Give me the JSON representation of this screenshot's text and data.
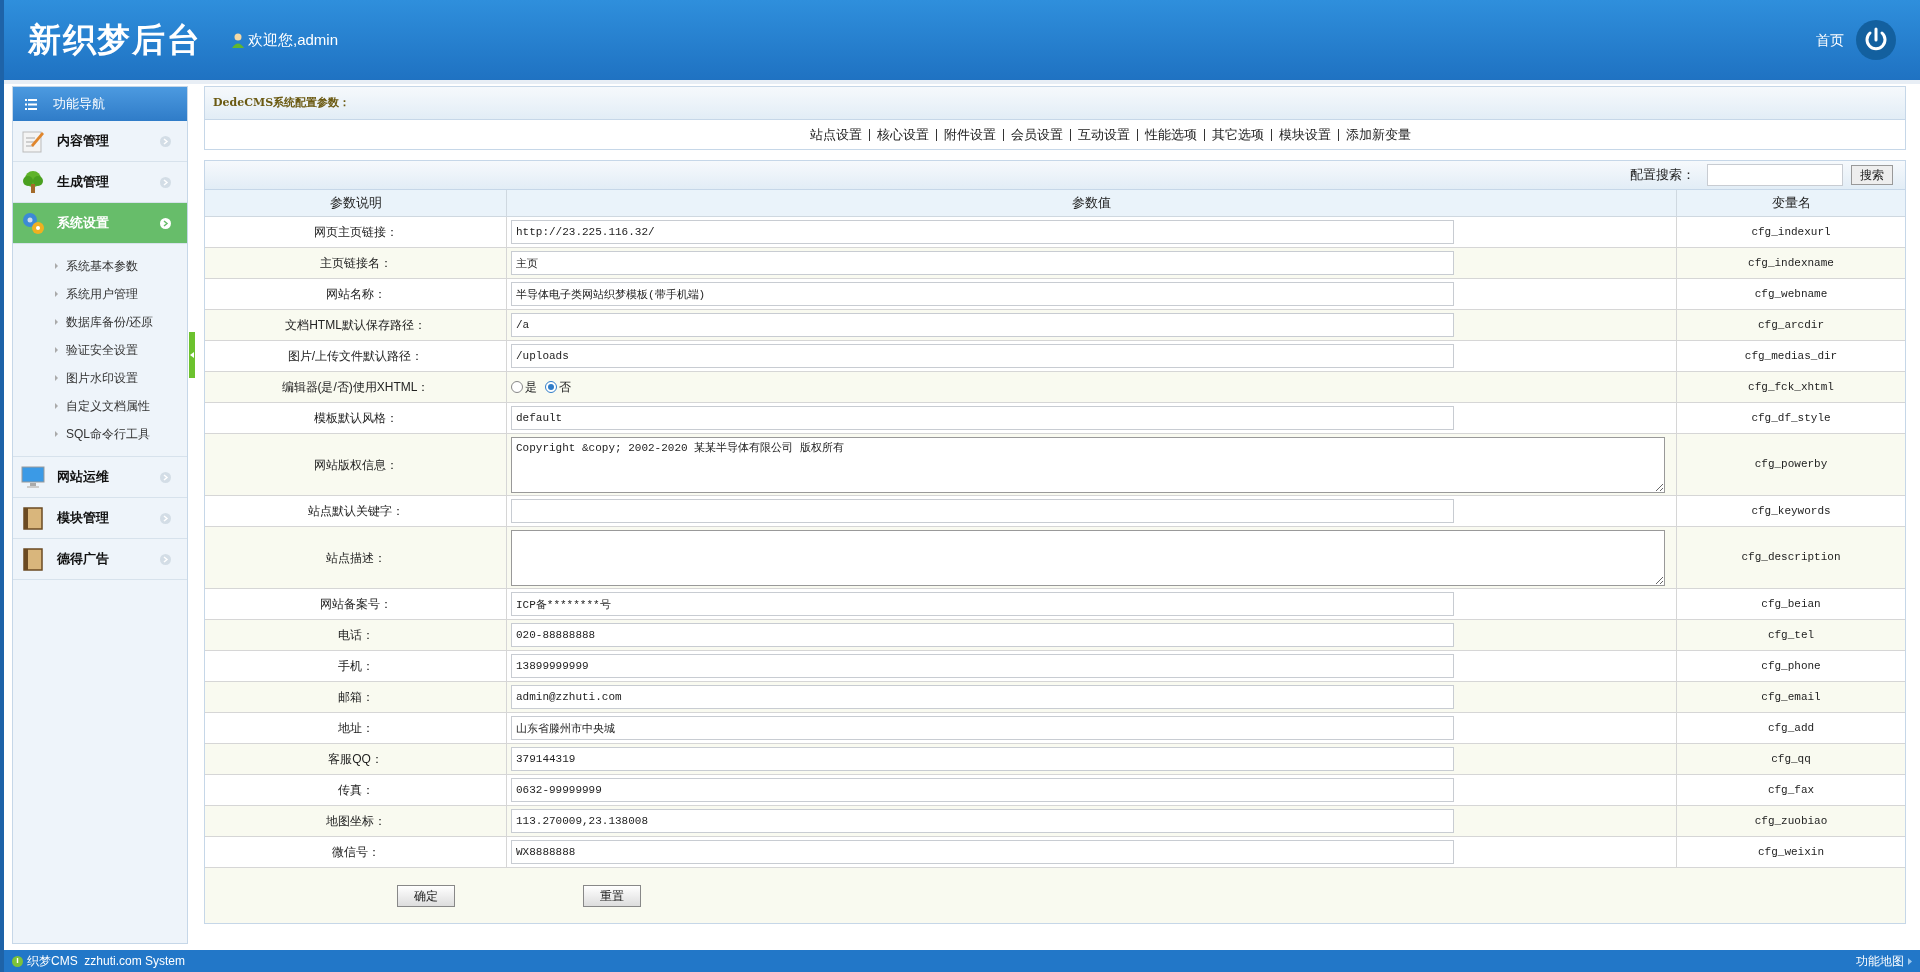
{
  "header": {
    "logo": "新织梦后台",
    "welcome": "欢迎您,admin",
    "home_link": "首页"
  },
  "sidebar": {
    "title": "功能导航",
    "items": [
      {
        "label": "内容管理",
        "selected": false
      },
      {
        "label": "生成管理",
        "selected": false
      },
      {
        "label": "系统设置",
        "selected": true,
        "children": [
          {
            "label": "系统基本参数"
          },
          {
            "label": "系统用户管理"
          },
          {
            "label": "数据库备份/还原"
          },
          {
            "label": "验证安全设置"
          },
          {
            "label": "图片水印设置"
          },
          {
            "label": "自定义文档属性"
          },
          {
            "label": "SQL命令行工具"
          }
        ]
      },
      {
        "label": "网站运维",
        "selected": false
      },
      {
        "label": "模块管理",
        "selected": false
      },
      {
        "label": "德得广告",
        "selected": false
      }
    ]
  },
  "config": {
    "title": "DedeCMS系统配置参数：",
    "tabs": [
      "站点设置",
      "核心设置",
      "附件设置",
      "会员设置",
      "互动设置",
      "性能选项",
      "其它选项",
      "模块设置",
      "添加新变量"
    ]
  },
  "search": {
    "label": "配置搜索：",
    "button": "搜索"
  },
  "table": {
    "columns": [
      "参数说明",
      "参数值",
      "变量名"
    ],
    "rows": [
      {
        "label": "网页主页链接：",
        "kind": "text",
        "value": "http://23.225.116.32/",
        "var": "cfg_indexurl"
      },
      {
        "label": "主页链接名：",
        "kind": "text",
        "value": "主页",
        "var": "cfg_indexname"
      },
      {
        "label": "网站名称：",
        "kind": "text",
        "value": "半导体电子类网站织梦模板(带手机端)",
        "var": "cfg_webname"
      },
      {
        "label": "文档HTML默认保存路径：",
        "kind": "text",
        "value": "/a",
        "var": "cfg_arcdir"
      },
      {
        "label": "图片/上传文件默认路径：",
        "kind": "text",
        "value": "/uploads",
        "var": "cfg_medias_dir"
      },
      {
        "label": "编辑器(是/否)使用XHTML：",
        "kind": "radio",
        "options": [
          {
            "label": "是",
            "selected": false
          },
          {
            "label": "否",
            "selected": true
          }
        ],
        "var": "cfg_fck_xhtml"
      },
      {
        "label": "模板默认风格：",
        "kind": "text",
        "value": "default",
        "var": "cfg_df_style"
      },
      {
        "label": "网站版权信息：",
        "kind": "textarea",
        "value": "Copyright &copy; 2002-2020 某某半导体有限公司 版权所有",
        "var": "cfg_powerby"
      },
      {
        "label": "站点默认关键字：",
        "kind": "text",
        "var": "cfg_keywords"
      },
      {
        "label": "站点描述：",
        "kind": "textarea",
        "var": "cfg_description"
      },
      {
        "label": "网站备案号：",
        "kind": "text",
        "value": "ICP备********号",
        "var": "cfg_beian"
      },
      {
        "label": "电话：",
        "kind": "text",
        "value": "020-88888888",
        "var": "cfg_tel"
      },
      {
        "label": "手机：",
        "kind": "text",
        "value": "13899999999",
        "var": "cfg_phone"
      },
      {
        "label": "邮箱：",
        "kind": "text",
        "value": "admin@zzhuti.com",
        "var": "cfg_email"
      },
      {
        "label": "地址：",
        "kind": "text",
        "value": "山东省滕州市中央城",
        "var": "cfg_add"
      },
      {
        "label": "客服QQ：",
        "kind": "text",
        "value": "379144319",
        "var": "cfg_qq"
      },
      {
        "label": "传真：",
        "kind": "text",
        "value": "0632-99999999",
        "var": "cfg_fax"
      },
      {
        "label": "地图坐标：",
        "kind": "text",
        "value": "113.270009,23.138008",
        "var": "cfg_zuobiao"
      },
      {
        "label": "微信号：",
        "kind": "text",
        "value": "WX8888888",
        "var": "cfg_weixin"
      }
    ]
  },
  "buttons": [
    "确定",
    "重置"
  ],
  "status_bar": {
    "text": "织梦CMS  zzhuti.com System",
    "sitemap": "功能地图"
  }
}
